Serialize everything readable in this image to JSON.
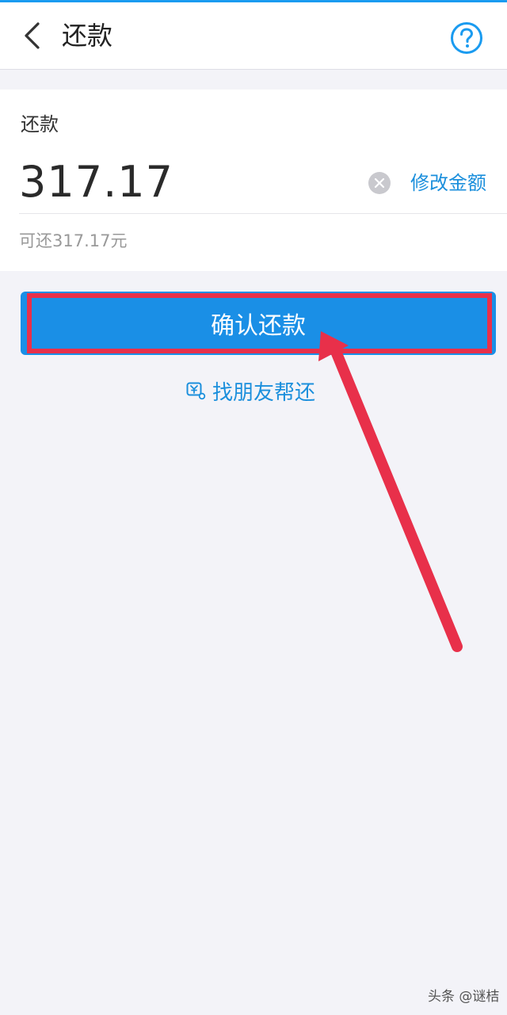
{
  "header": {
    "title": "还款",
    "back_icon": "chevron-left-icon",
    "help_icon": "question-circle-icon"
  },
  "repayment": {
    "label": "还款",
    "amount": "317.17",
    "clear_icon": "clear-icon",
    "modify_label": "修改金额",
    "available_text": "可还317.17元"
  },
  "actions": {
    "confirm_label": "确认还款",
    "friend_help_label": "找朋友帮还",
    "friend_icon": "friend-pay-icon"
  },
  "watermark": "头条 @谜桔",
  "colors": {
    "accent": "#1a8fe6",
    "link": "#1b8fdc",
    "annotation": "#e8304a",
    "background": "#f3f3f8"
  }
}
